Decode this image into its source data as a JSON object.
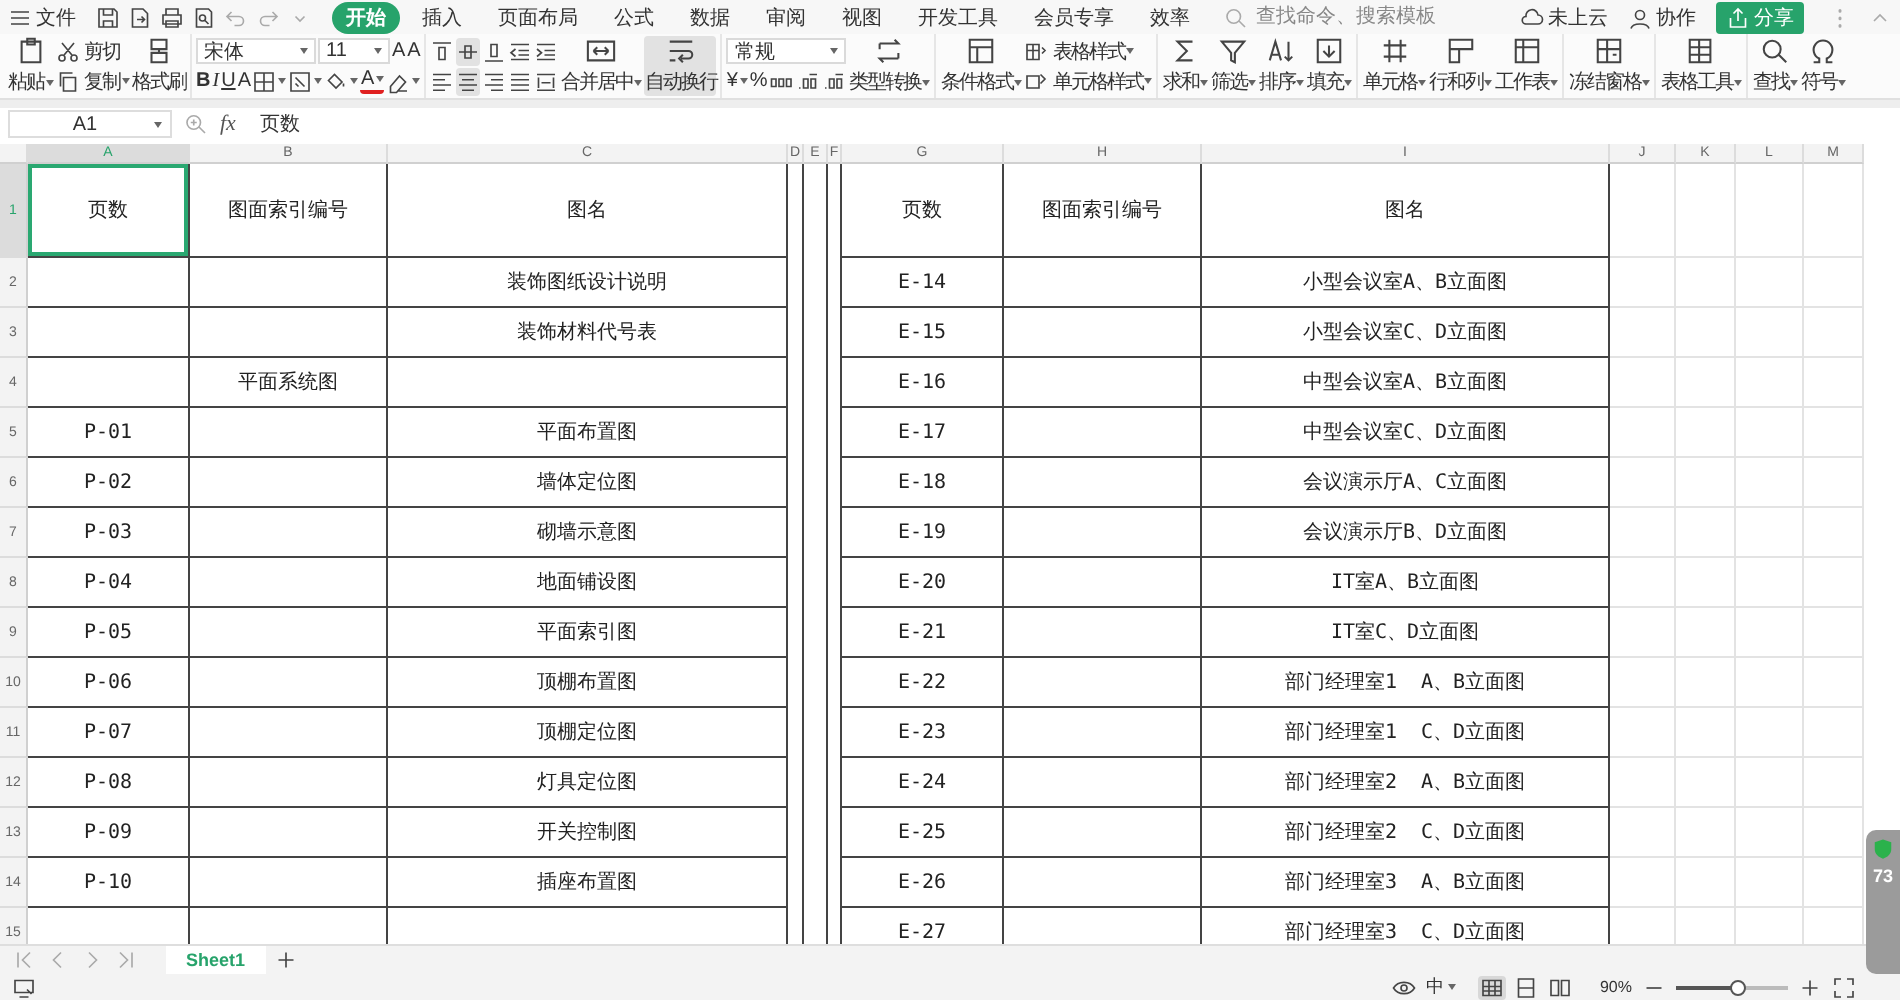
{
  "file_menu": "文件",
  "tabs": [
    {
      "label": "开始",
      "selected": true
    },
    {
      "label": "插入",
      "selected": false
    },
    {
      "label": "页面布局",
      "selected": false
    },
    {
      "label": "公式",
      "selected": false
    },
    {
      "label": "数据",
      "selected": false
    },
    {
      "label": "审阅",
      "selected": false
    },
    {
      "label": "视图",
      "selected": false
    },
    {
      "label": "开发工具",
      "selected": false
    },
    {
      "label": "会员专享",
      "selected": false
    },
    {
      "label": "效率",
      "selected": false
    }
  ],
  "search": {
    "placeholder": "查找命令、搜索模板"
  },
  "account": {
    "cloud": "未上云",
    "collaborate": "协作",
    "share": "分享"
  },
  "ribbon": {
    "groups": [
      {
        "items": [
          {
            "kind": "large",
            "label": "粘贴",
            "dropdown": true,
            "selected": false
          },
          {
            "kind": "pair",
            "items": [
              {
                "label": "剪切",
                "dropdown": false
              },
              {
                "label": "复制",
                "dropdown": true
              }
            ]
          },
          {
            "kind": "large",
            "label": "格式刷",
            "dropdown": false,
            "selected": false
          }
        ]
      },
      {
        "items": [
          {
            "kind": "grid",
            "top_row": [
              {
                "kind": "select",
                "value": "宋体"
              },
              {
                "kind": "select",
                "value": "11"
              },
              {
                "kind": "grow",
                "label": "A"
              },
              {
                "kind": "shrink",
                "label": "A"
              }
            ],
            "bottom_row": [
              {
                "kind": "bold",
                "label": "B"
              },
              {
                "kind": "italic",
                "label": "I"
              },
              {
                "kind": "underline",
                "label": "U"
              },
              {
                "kind": "strike",
                "label": "A"
              },
              {
                "kind": "icon",
                "dropdown": true
              },
              {
                "kind": "icon",
                "dropdown": true
              },
              {
                "kind": "icon",
                "dropdown": true
              },
              {
                "kind": "fontcolor",
                "label": "A",
                "dropdown": true
              },
              {
                "kind": "icon",
                "dropdown": true
              }
            ]
          }
        ]
      },
      {
        "items": [
          {
            "kind": "grid",
            "top_row": [
              {
                "kind": "icon",
                "selected": false
              },
              {
                "kind": "icon",
                "selected": true
              },
              {
                "kind": "icon",
                "selected": false
              },
              {
                "kind": "icon",
                "selected": false
              },
              {
                "kind": "icon",
                "selected": false
              }
            ],
            "bottom_row": [
              {
                "kind": "icon",
                "selected": false
              },
              {
                "kind": "icon",
                "selected": true
              },
              {
                "kind": "icon",
                "selected": false
              },
              {
                "kind": "icon",
                "selected": false
              },
              {
                "kind": "icon",
                "selected": false
              }
            ]
          },
          {
            "kind": "large",
            "label": "合并居中",
            "dropdown": true,
            "selected": false
          },
          {
            "kind": "large",
            "label": "自动换行",
            "dropdown": false,
            "selected": true
          }
        ]
      },
      {
        "items": [
          {
            "kind": "grid",
            "top_row": [
              {
                "kind": "select",
                "value": "常规"
              }
            ],
            "bottom_row": [
              {
                "kind": "char",
                "label": "¥",
                "dropdown": true
              },
              {
                "kind": "char",
                "label": "%"
              },
              {
                "kind": "icon"
              },
              {
                "kind": "icon"
              },
              {
                "kind": "icon"
              }
            ]
          },
          {
            "kind": "large",
            "label": "类型转换",
            "dropdown": true,
            "selected": false
          }
        ]
      },
      {
        "items": [
          {
            "kind": "large",
            "label": "条件格式",
            "dropdown": true,
            "selected": false
          },
          {
            "kind": "pair",
            "items": [
              {
                "label": "表格样式",
                "dropdown": true
              },
              {
                "label": "单元格样式",
                "dropdown": true
              }
            ]
          }
        ]
      },
      {
        "items": [
          {
            "kind": "large",
            "label": "求和",
            "dropdown": true,
            "selected": false
          },
          {
            "kind": "large",
            "label": "筛选",
            "dropdown": true,
            "selected": false
          },
          {
            "kind": "large",
            "label": "排序",
            "dropdown": true,
            "selected": false
          },
          {
            "kind": "large",
            "label": "填充",
            "dropdown": true,
            "selected": false
          }
        ]
      },
      {
        "items": [
          {
            "kind": "large",
            "label": "单元格",
            "dropdown": true,
            "selected": false
          },
          {
            "kind": "large",
            "label": "行和列",
            "dropdown": true,
            "selected": false
          },
          {
            "kind": "large",
            "label": "工作表",
            "dropdown": true,
            "selected": false
          }
        ]
      },
      {
        "items": [
          {
            "kind": "large",
            "label": "冻结窗格",
            "dropdown": true,
            "selected": false
          }
        ]
      },
      {
        "items": [
          {
            "kind": "large",
            "label": "表格工具",
            "dropdown": true,
            "selected": false
          }
        ]
      },
      {
        "items": [
          {
            "kind": "large",
            "label": "查找",
            "dropdown": true,
            "selected": false
          },
          {
            "kind": "large",
            "label": "符号",
            "dropdown": true,
            "selected": false
          }
        ]
      }
    ]
  },
  "formula_bar": {
    "name_box": "A1",
    "fx": "fx",
    "formula": "页数"
  },
  "columns": [
    {
      "label": "A",
      "selected": true
    },
    {
      "label": "B",
      "selected": false
    },
    {
      "label": "C",
      "selected": false
    },
    {
      "label": "D",
      "selected": false
    },
    {
      "label": "E",
      "selected": false
    },
    {
      "label": "F",
      "selected": false
    },
    {
      "label": "G",
      "selected": false
    },
    {
      "label": "H",
      "selected": false
    },
    {
      "label": "I",
      "selected": false
    },
    {
      "label": "J",
      "selected": false
    },
    {
      "label": "K",
      "selected": false
    },
    {
      "label": "L",
      "selected": false
    },
    {
      "label": "M",
      "selected": false
    }
  ],
  "rows": [
    {
      "header": "1",
      "selected": true,
      "cells": {
        "A": "页数",
        "B": "图面索引编号",
        "C": "图名",
        "G": "页数",
        "H": "图面索引编号",
        "I": "图名"
      }
    },
    {
      "header": "2",
      "selected": false,
      "cells": {
        "C": "装饰图纸设计说明",
        "G": "E-14",
        "I": "小型会议室A、B立面图"
      }
    },
    {
      "header": "3",
      "selected": false,
      "cells": {
        "C": "装饰材料代号表",
        "G": "E-15",
        "I": "小型会议室C、D立面图"
      }
    },
    {
      "header": "4",
      "selected": false,
      "cells": {
        "B": "平面系统图",
        "G": "E-16",
        "I": "中型会议室A、B立面图"
      }
    },
    {
      "header": "5",
      "selected": false,
      "cells": {
        "A": "P-01",
        "C": "平面布置图",
        "G": "E-17",
        "I": "中型会议室C、D立面图"
      }
    },
    {
      "header": "6",
      "selected": false,
      "cells": {
        "A": "P-02",
        "C": "墙体定位图",
        "G": "E-18",
        "I": "会议演示厅A、C立面图"
      }
    },
    {
      "header": "7",
      "selected": false,
      "cells": {
        "A": "P-03",
        "C": "砌墙示意图",
        "G": "E-19",
        "I": "会议演示厅B、D立面图"
      }
    },
    {
      "header": "8",
      "selected": false,
      "cells": {
        "A": "P-04",
        "C": "地面铺设图",
        "G": "E-20",
        "I": "IT室A、B立面图"
      }
    },
    {
      "header": "9",
      "selected": false,
      "cells": {
        "A": "P-05",
        "C": "平面索引图",
        "G": "E-21",
        "I": "IT室C、D立面图"
      }
    },
    {
      "header": "10",
      "selected": false,
      "cells": {
        "A": "P-06",
        "C": "顶棚布置图",
        "G": "E-22",
        "I": "部门经理室1  A、B立面图"
      }
    },
    {
      "header": "11",
      "selected": false,
      "cells": {
        "A": "P-07",
        "C": "顶棚定位图",
        "G": "E-23",
        "I": "部门经理室1  C、D立面图"
      }
    },
    {
      "header": "12",
      "selected": false,
      "cells": {
        "A": "P-08",
        "C": "灯具定位图",
        "G": "E-24",
        "I": "部门经理室2  A、B立面图"
      }
    },
    {
      "header": "13",
      "selected": false,
      "cells": {
        "A": "P-09",
        "C": "开关控制图",
        "G": "E-25",
        "I": "部门经理室2  C、D立面图"
      }
    },
    {
      "header": "14",
      "selected": false,
      "cells": {
        "A": "P-10",
        "C": "插座布置图",
        "G": "E-26",
        "I": "部门经理室3  A、B立面图"
      }
    },
    {
      "header": "15",
      "selected": false,
      "cells": {
        "G": "E-27",
        "I": "部门经理室3  C、D立面图"
      }
    }
  ],
  "sheets": [
    {
      "label": "Sheet1",
      "selected": true
    }
  ],
  "status_bar": {
    "layout": "中",
    "views": [
      {
        "selected": true
      },
      {
        "selected": false
      },
      {
        "selected": false
      }
    ],
    "zoom": "90%",
    "zoom_slider": {
      "level": 0.55
    }
  },
  "monitor_widget": {
    "reading": "73"
  }
}
